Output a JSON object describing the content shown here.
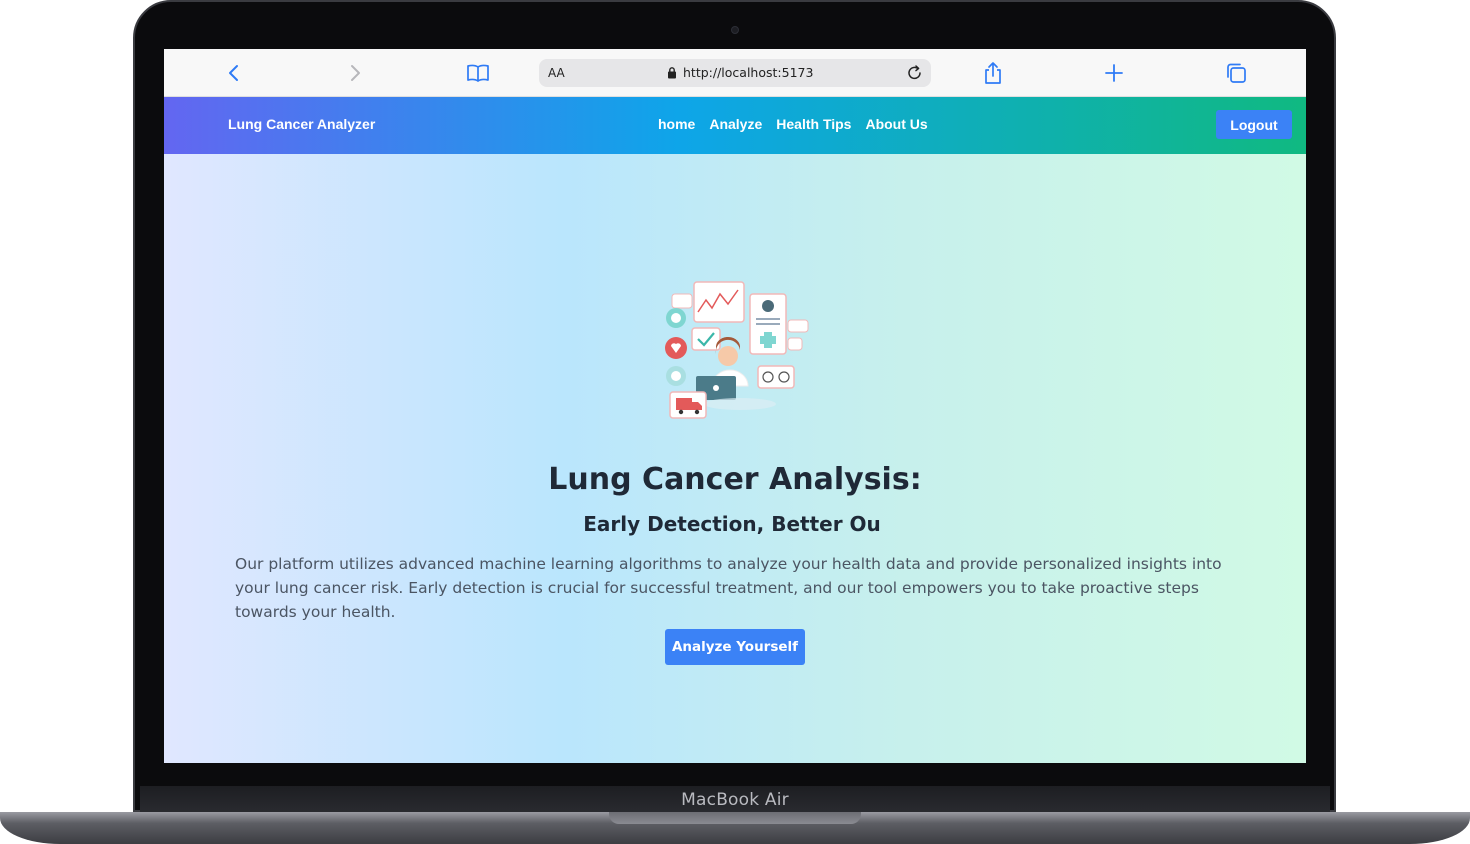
{
  "device": {
    "label": "MacBook Air"
  },
  "browser": {
    "reader_label": "AA",
    "url": "http://localhost:5173",
    "icons": [
      "back-icon",
      "forward-icon",
      "bookmarks-icon",
      "lock-icon",
      "reload-icon",
      "share-icon",
      "new-tab-icon",
      "tabs-icon"
    ]
  },
  "navbar": {
    "brand": "Lung Cancer Analyzer",
    "links": [
      "home",
      "Analyze",
      "Health Tips",
      "About Us"
    ],
    "logout_label": "Logout"
  },
  "hero": {
    "illustration": "medical-analysis-illustration",
    "title": "Lung Cancer Analysis:",
    "subtitle": "Early Detection, Better Ou",
    "description": "Our platform utilizes advanced machine learning algorithms to analyze your health data and provide personalized insights into your lung cancer risk. Early detection is crucial for successful treatment, and our tool empowers you to take proactive steps towards your health.",
    "cta_label": "Analyze Yourself"
  },
  "colors": {
    "nav_gradient": [
      "#6366f1",
      "#0ea5e9",
      "#10b981"
    ],
    "primary_button": "#3b82f6",
    "hero_gradient": [
      "#e0e7ff",
      "#bae6fd",
      "#d1fae5"
    ]
  }
}
